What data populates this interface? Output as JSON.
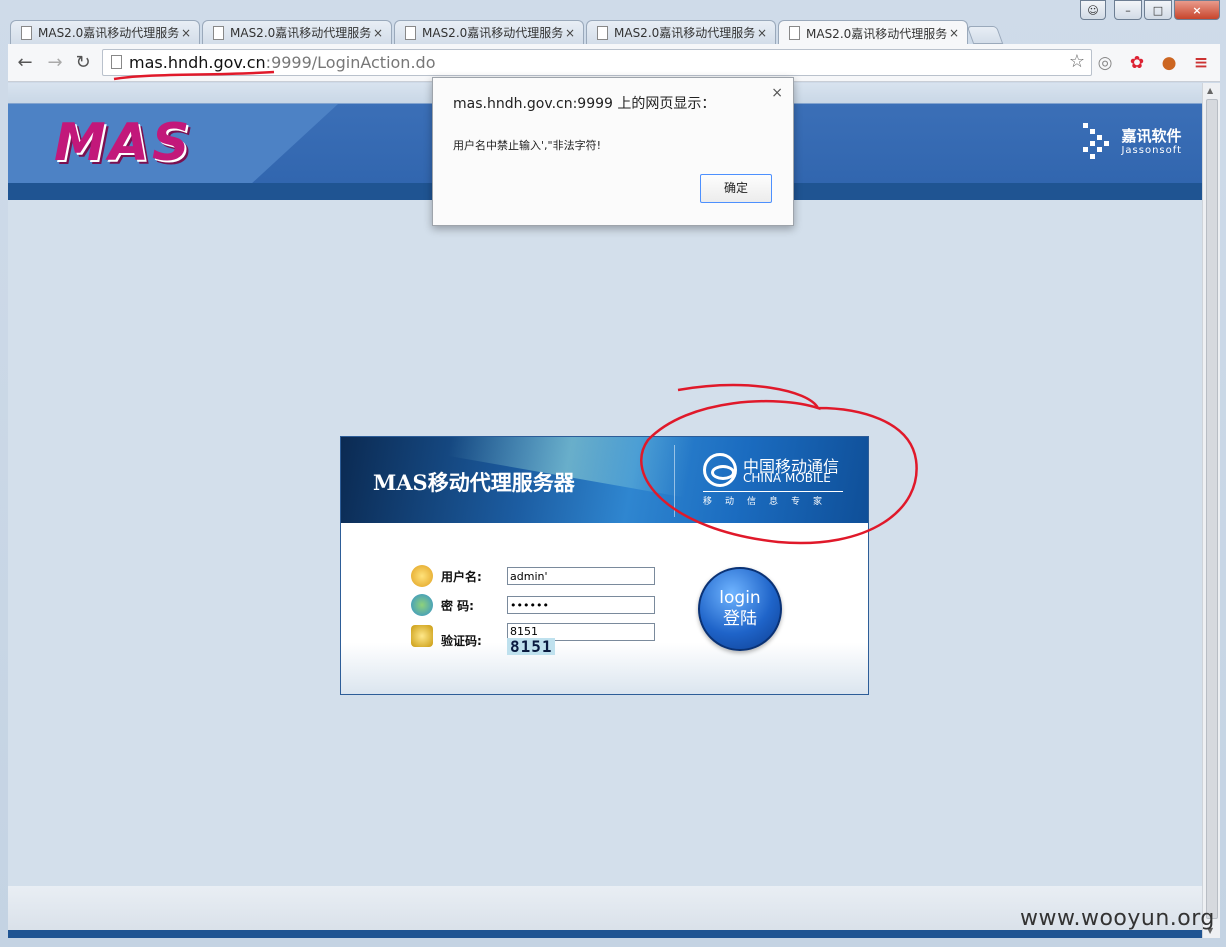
{
  "browser": {
    "tabs": [
      {
        "label": "MAS2.0嘉讯移动代理服务器"
      },
      {
        "label": "MAS2.0嘉讯移动代理服务器"
      },
      {
        "label": "MAS2.0嘉讯移动代理服务器"
      },
      {
        "label": "MAS2.0嘉讯移动代理服务器"
      },
      {
        "label": "MAS2.0嘉讯移动代理服务器"
      }
    ],
    "tab_close_glyph": "×",
    "address": {
      "host": "mas.hndh.gov.cn",
      "rest": ":9999/LoginAction.do"
    },
    "icons": [
      "back-icon",
      "forward-icon",
      "reload-icon",
      "bookmark-star-icon",
      "extension-icon",
      "menu-icon"
    ]
  },
  "site": {
    "logo_text": "MAS",
    "company_cn": "嘉讯软件",
    "company_en": "Jassonsoft"
  },
  "login": {
    "banner_title": "MAS移动代理服务器",
    "brand_cn": "中国移动通信",
    "brand_en": "CHINA MOBILE",
    "brand_slogan": "移动信息专家",
    "username_label": "用户名:",
    "password_label": "密  码:",
    "captcha_label": "验证码:",
    "username_value": "admin'",
    "password_value": "••••••",
    "captcha_value": "8151",
    "captcha_image_text": "8151",
    "button_line1": "login",
    "button_line2": "登陆"
  },
  "dialog": {
    "title": "mas.hndh.gov.cn:9999 上的网页显示：",
    "message": "用户名中禁止输入',\"非法字符!",
    "ok_label": "确定",
    "close_glyph": "×"
  },
  "watermark": "www.wooyun.org",
  "colors": {
    "annotation_red": "#e0192a",
    "header_blue": "#2f64ad",
    "logo_magenta": "#c2187a"
  }
}
